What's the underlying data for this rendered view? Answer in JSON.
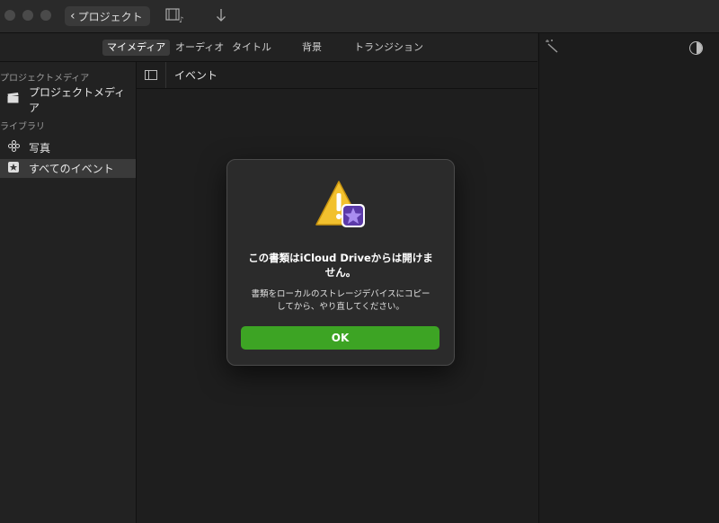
{
  "titlebar": {
    "back_label": "プロジェクト",
    "media_icon": "film-music-icon",
    "import_icon": "download-arrow-icon"
  },
  "tabs": [
    "マイメディア",
    "オーディオ",
    "タイトル",
    "背景",
    "トランジション"
  ],
  "active_tab": "マイメディア",
  "sidebar": {
    "section_project": "プロジェクトメディア",
    "item_project_media": "プロジェクトメディア",
    "section_library": "ライブラリ",
    "item_photos": "写真",
    "item_all_events": "すべてのイベント"
  },
  "content": {
    "header_label": "イベント"
  },
  "dialog": {
    "title_line1": "この書類はiCloud Driveからは開けま",
    "title_line2": "せん。",
    "message_line1": "書類をローカルのストレージデバイスにコピー",
    "message_line2": "してから、やり直してください。",
    "ok_label": "OK"
  },
  "colors": {
    "ok_button": "#3da424",
    "warning": "#f2c12e",
    "badge": "#5b3aa8"
  }
}
